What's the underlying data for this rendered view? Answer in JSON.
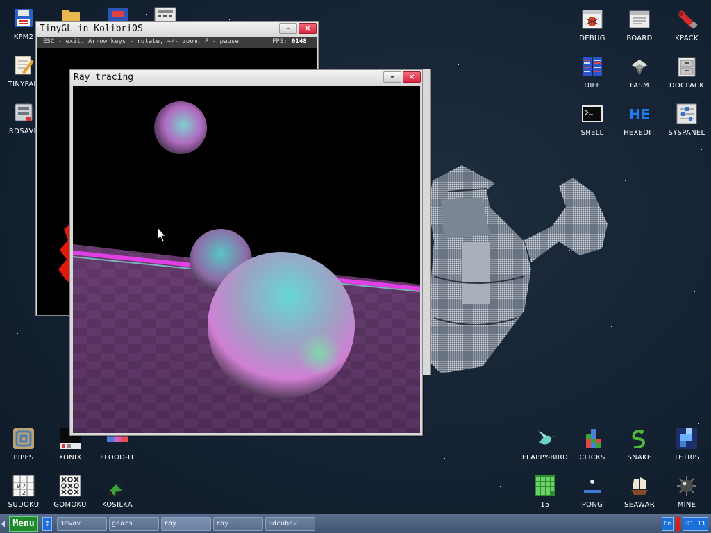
{
  "desktop_icons": {
    "kfm2": "KFM2",
    "tinypad": "TINYPAD",
    "rdsave": "RDSAVE",
    "debug": "DEBUG",
    "board": "BOARD",
    "kpack": "KPACK",
    "diff": "DIFF",
    "fasm": "FASM",
    "docpack": "DOCPACK",
    "shell": "SHELL",
    "hexedit": "HEXEDIT",
    "syspanel": "SYSPANEL",
    "pipes": "PIPES",
    "xonix": "XONIX",
    "floodit": "FLOOD-IT",
    "flappybird": "FLAPPY-BIRD",
    "clicks": "CLICKS",
    "snake": "SNAKE",
    "tetris": "TETRIS",
    "sudoku": "SUDOKU",
    "gomoku": "GOMOKU",
    "kosilka": "KOSILKA",
    "fifteen": "15",
    "pong": "PONG",
    "seawar": "SEAWAR",
    "mine": "MINE"
  },
  "tinygl_window": {
    "title": "TinyGL in KolibriOS",
    "hint": "ESC - exit. Arrow keys - rotate, +/- zoom, P - pause",
    "fps_label": "FPS:",
    "fps_value": "0148"
  },
  "ray_window": {
    "title": "Ray tracing"
  },
  "window_buttons": {
    "minimize": "–",
    "close": "×"
  },
  "taskbar": {
    "menu": "Menu",
    "switch_icon": "↕",
    "tasks": [
      "3dwav",
      "gears",
      "ray",
      "ray",
      "3dcube2"
    ],
    "lang": "En",
    "clock": "01 13"
  },
  "colors": {
    "desktop_bg": "#142233",
    "taskbar": "#4a5e7e",
    "menu_button": "#1f8a2c",
    "close_button": "#d7243d",
    "clock_bg": "#1a6fd8",
    "lang_bg": "#1a6fd8"
  }
}
